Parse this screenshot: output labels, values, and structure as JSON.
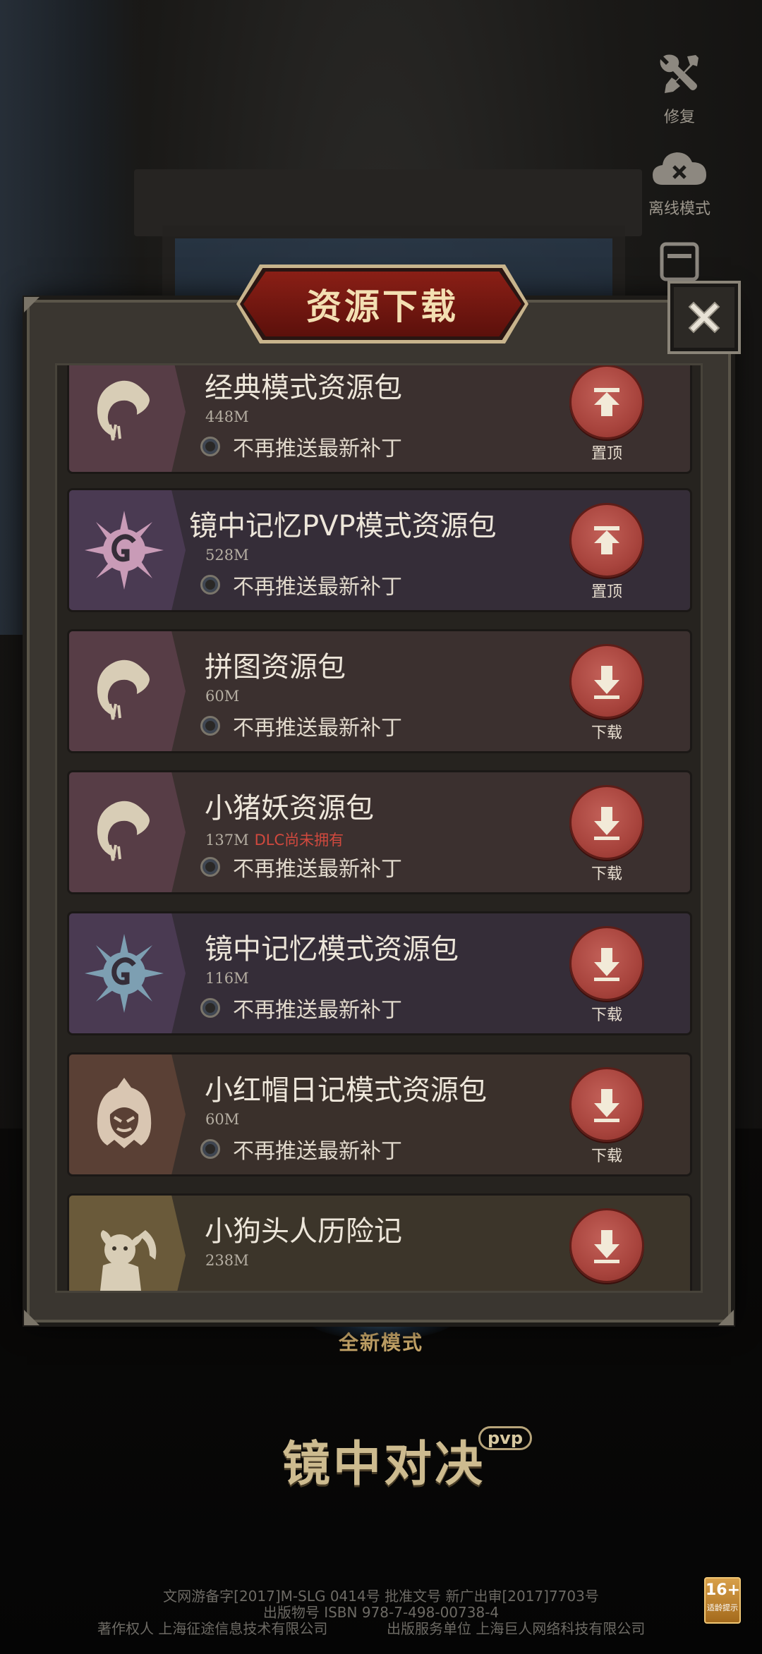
{
  "background": {
    "new_mode_label": "全新模式",
    "game_logo": "镜中对决",
    "game_logo_badge": "pvp"
  },
  "side_buttons": {
    "repair": "修复",
    "offline": "离线模式"
  },
  "modal": {
    "title": "资源下载",
    "close_icon": "close-icon"
  },
  "check_label": "不再推送最新补丁",
  "items": [
    {
      "name": "经典模式资源包",
      "size": "448M",
      "dlc": "",
      "action": "置顶",
      "action_icon": "pin-top-icon",
      "icon": "swirl-moon-icon"
    },
    {
      "name": "镜中记忆PVP模式资源包",
      "size": "528M",
      "dlc": "",
      "action": "置顶",
      "action_icon": "pin-top-icon",
      "icon": "spiky-g-pink-icon"
    },
    {
      "name": "拼图资源包",
      "size": "60M",
      "dlc": "",
      "action": "下载",
      "action_icon": "download-icon",
      "icon": "swirl-moon-icon"
    },
    {
      "name": "小猪妖资源包",
      "size": "137M",
      "dlc": "DLC尚未拥有",
      "action": "下载",
      "action_icon": "download-icon",
      "icon": "swirl-moon-icon"
    },
    {
      "name": "镜中记忆模式资源包",
      "size": "116M",
      "dlc": "",
      "action": "下载",
      "action_icon": "download-icon",
      "icon": "spiky-g-blue-icon"
    },
    {
      "name": "小红帽日记模式资源包",
      "size": "60M",
      "dlc": "",
      "action": "下载",
      "action_icon": "download-icon",
      "icon": "red-hood-icon"
    },
    {
      "name": "小狗头人历险记",
      "size": "238M",
      "dlc": "",
      "action": "",
      "action_icon": "download-icon",
      "icon": "dog-kobold-icon"
    }
  ],
  "footer": {
    "line1": "文网游备字[2017]M-SLG 0414号 批准文号 新广出审[2017]7703号",
    "line2": "出版物号 ISBN 978-7-498-00738-4",
    "line3_left": "著作权人 上海征途信息技术有限公司",
    "line3_right": "出版服务单位 上海巨人网络科技有限公司",
    "age_rating": "16+",
    "age_text": "适龄提示"
  },
  "colors": {
    "title_plate": "#8a1f16",
    "action_button": "#a8443d",
    "dlc_warning": "#d1493e",
    "modal_bg": "#26231f"
  }
}
